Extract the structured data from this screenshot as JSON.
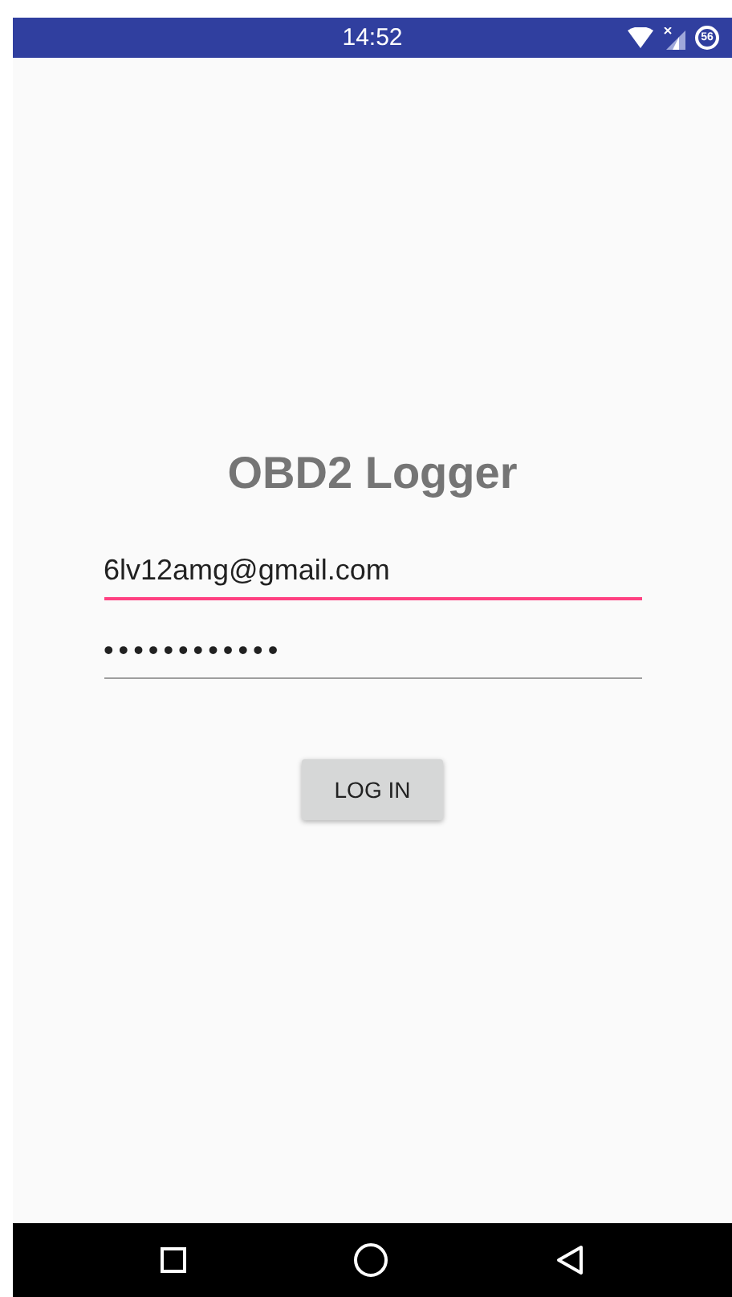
{
  "status_bar": {
    "time": "14:52",
    "battery": "56"
  },
  "title": "OBD2 Logger",
  "fields": [
    {
      "kind": "email",
      "value": "6lv12amg@gmail.com",
      "focused": true
    },
    {
      "kind": "password",
      "value": "••••••••••••",
      "focused": false
    }
  ],
  "button": "LOG IN"
}
